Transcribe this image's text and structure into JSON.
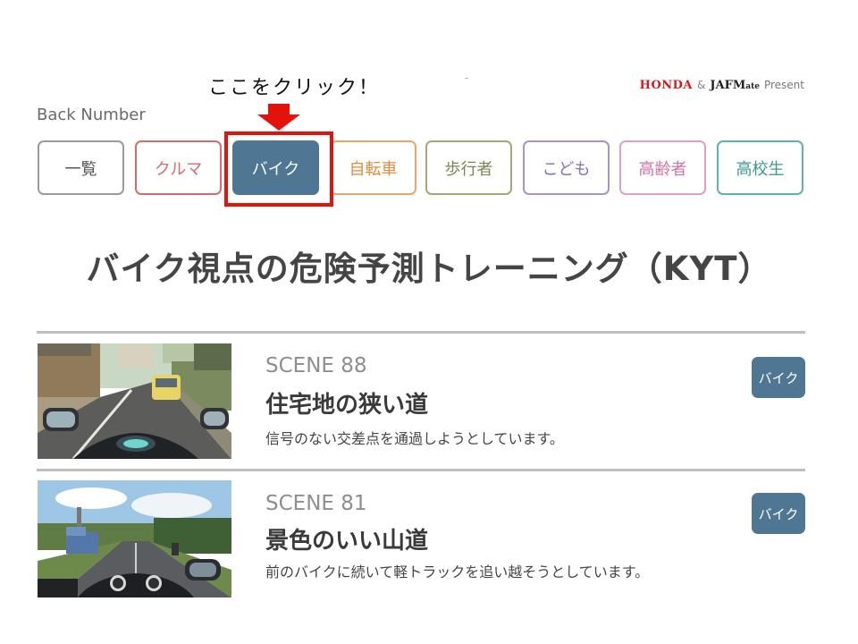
{
  "callout": {
    "text": "ここをクリック！",
    "arrow_icon": "down-arrow-icon",
    "color": "#e3120b"
  },
  "sponsor": {
    "honda": "HONDA",
    "ampersand": "&",
    "jaf": "JAFM",
    "mate": "ate",
    "present": "Present"
  },
  "back_number_label": "Back Number",
  "categories": [
    {
      "label": "一覧",
      "border": "#9a9a9a",
      "color": "#555555",
      "active": false
    },
    {
      "label": "クルマ",
      "border": "#d46b73",
      "color": "#d46b73",
      "active": false
    },
    {
      "label": "バイク",
      "border": "#4f7794",
      "color": "#ffffff",
      "active": true
    },
    {
      "label": "自転車",
      "border": "#e9a56a",
      "color": "#e08b3f",
      "active": false
    },
    {
      "label": "歩行者",
      "border": "#a3a77a",
      "color": "#7f8457",
      "active": false
    },
    {
      "label": "こども",
      "border": "#a793c4",
      "color": "#8670ad",
      "active": false
    },
    {
      "label": "高齢者",
      "border": "#e0a0c3",
      "color": "#cf73a5",
      "active": false
    },
    {
      "label": "高校生",
      "border": "#5bb3ad",
      "color": "#3e9892",
      "active": false
    }
  ],
  "title": "バイク視点の危険予測トレーニング（KYT）",
  "scenes": [
    {
      "number": "SCENE 88",
      "title": "住宅地の狭い道",
      "description": "信号のない交差点を通過しようとしています。",
      "tag": "バイク"
    },
    {
      "number": "SCENE 81",
      "title": "景色のいい山道",
      "description": "前のバイクに続いて軽トラックを追い越そうとしています。",
      "tag": "バイク"
    }
  ],
  "colors": {
    "accent": "#4f7794",
    "highlight": "#e3120b",
    "divider": "#bfbfbf"
  }
}
